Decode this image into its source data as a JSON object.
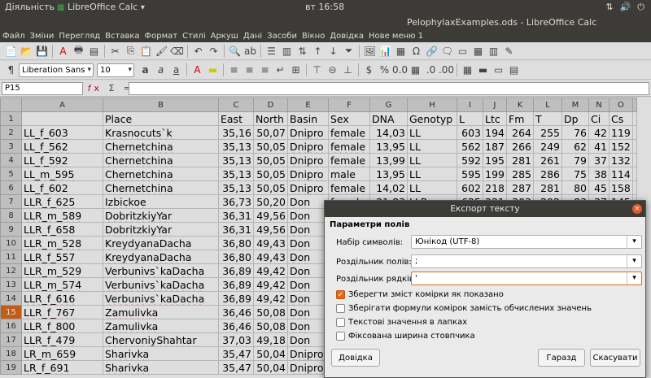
{
  "top_panel": {
    "activities": "Діяльність",
    "app": "LibreOffice Calc",
    "clock": "вт 16:58"
  },
  "window": {
    "title": "PelophylaxExamples.ods - LibreOffice Calc"
  },
  "menu": [
    "Файл",
    "Зміни",
    "Перегляд",
    "Вставка",
    "Формат",
    "Стилі",
    "Аркуш",
    "Дані",
    "Засоби",
    "Вікно",
    "Довідка",
    "Нове меню 1"
  ],
  "toolbar": {
    "font_name": "Liberation Sans",
    "font_size": "10"
  },
  "formula_bar": {
    "cell_ref": "P15",
    "fx": "Σ ="
  },
  "columns": [
    "A",
    "B",
    "C",
    "D",
    "E",
    "F",
    "G",
    "H",
    "I",
    "J",
    "K",
    "L",
    "M",
    "N",
    "O"
  ],
  "rows": [
    {
      "n": "1",
      "A": "",
      "B": "Place",
      "C": "East",
      "D": "North",
      "E": "Basin",
      "F": "Sex",
      "G": "DNA",
      "H": "Genotyp",
      "I": "L",
      "J": "Ltc",
      "K": "Fm",
      "L": "T",
      "M": "Dp",
      "N": "Ci",
      "O": "Cs"
    },
    {
      "n": "2",
      "A": "LL_f_603",
      "B": "Krasnocuts`k",
      "C": "35,16",
      "D": "50,07",
      "E": "Dnipro",
      "F": "female",
      "G": "14,03",
      "H": "LL",
      "I": "603",
      "J": "194",
      "K": "264",
      "L": "255",
      "M": "76",
      "N": "42",
      "O": "119"
    },
    {
      "n": "3",
      "A": "LL_f_562",
      "B": "Chernetchina",
      "C": "35,13",
      "D": "50,05",
      "E": "Dnipro",
      "F": "female",
      "G": "13,95",
      "H": "LL",
      "I": "562",
      "J": "187",
      "K": "266",
      "L": "249",
      "M": "62",
      "N": "41",
      "O": "152"
    },
    {
      "n": "4",
      "A": "LL_f_592",
      "B": "Chernetchina",
      "C": "35,13",
      "D": "50,05",
      "E": "Dnipro",
      "F": "female",
      "G": "13,99",
      "H": "LL",
      "I": "592",
      "J": "195",
      "K": "281",
      "L": "261",
      "M": "79",
      "N": "37",
      "O": "132"
    },
    {
      "n": "5",
      "A": "LL_m_595",
      "B": "Chernetchina",
      "C": "35,13",
      "D": "50,05",
      "E": "Dnipro",
      "F": "male",
      "G": "13,95",
      "H": "LL",
      "I": "595",
      "J": "199",
      "K": "285",
      "L": "286",
      "M": "75",
      "N": "38",
      "O": "114"
    },
    {
      "n": "6",
      "A": "LL_f_602",
      "B": "Chernetchina",
      "C": "35,13",
      "D": "50,05",
      "E": "Dnipro",
      "F": "female",
      "G": "14,02",
      "H": "LL",
      "I": "602",
      "J": "218",
      "K": "287",
      "L": "281",
      "M": "80",
      "N": "45",
      "O": "158"
    },
    {
      "n": "7",
      "A": "LLR_f_625",
      "B": "Izbickoe",
      "C": "36,73",
      "D": "50,20",
      "E": "Don",
      "F": "female",
      "G": "21,83",
      "H": "LLR",
      "I": "625",
      "J": "221",
      "K": "303",
      "L": "292",
      "M": "83",
      "N": "37",
      "O": "145"
    },
    {
      "n": "8",
      "A": "LLR_m_589",
      "B": "DobritzkiyYar",
      "C": "36,31",
      "D": "49,56",
      "E": "Don",
      "F": "",
      "G": "",
      "H": "",
      "I": "",
      "J": "",
      "K": "",
      "L": "",
      "M": "",
      "N": "",
      "O": ""
    },
    {
      "n": "9",
      "A": "LLR_f_658",
      "B": "DobritzkiyYar",
      "C": "36,31",
      "D": "49,56",
      "E": "Don",
      "F": "",
      "G": "",
      "H": "",
      "I": "",
      "J": "",
      "K": "",
      "L": "",
      "M": "",
      "N": "",
      "O": ""
    },
    {
      "n": "10",
      "A": "LLR_m_528",
      "B": "KreydyanaDacha",
      "C": "36,80",
      "D": "49,43",
      "E": "Don",
      "F": "",
      "G": "",
      "H": "",
      "I": "",
      "J": "",
      "K": "",
      "L": "",
      "M": "",
      "N": "",
      "O": ""
    },
    {
      "n": "11",
      "A": "LLR_f_557",
      "B": "KreydyanaDacha",
      "C": "36,80",
      "D": "49,43",
      "E": "Don",
      "F": "",
      "G": "",
      "H": "",
      "I": "",
      "J": "",
      "K": "",
      "L": "",
      "M": "",
      "N": "",
      "O": ""
    },
    {
      "n": "12",
      "A": "LLR_m_529",
      "B": "Verbunivs`kaDacha",
      "C": "36,89",
      "D": "49,42",
      "E": "Don",
      "F": "",
      "G": "",
      "H": "",
      "I": "",
      "J": "",
      "K": "",
      "L": "",
      "M": "",
      "N": "",
      "O": ""
    },
    {
      "n": "13",
      "A": "LLR_m_574",
      "B": "Verbunivs`kaDacha",
      "C": "36,89",
      "D": "49,42",
      "E": "Don",
      "F": "",
      "G": "",
      "H": "",
      "I": "",
      "J": "",
      "K": "",
      "L": "",
      "M": "",
      "N": "",
      "O": ""
    },
    {
      "n": "14",
      "A": "LLR_f_616",
      "B": "Verbunivs`kaDacha",
      "C": "36,89",
      "D": "49,42",
      "E": "Don",
      "F": "",
      "G": "",
      "H": "",
      "I": "",
      "J": "",
      "K": "",
      "L": "",
      "M": "",
      "N": "",
      "O": ""
    },
    {
      "n": "15",
      "A": "LLR_f_767",
      "B": "Zamulivka",
      "C": "36,46",
      "D": "50,08",
      "E": "Don",
      "F": "",
      "G": "",
      "H": "",
      "I": "",
      "J": "",
      "K": "",
      "L": "",
      "M": "",
      "N": "",
      "O": ""
    },
    {
      "n": "16",
      "A": "LLR_f_800",
      "B": "Zamulivka",
      "C": "36,46",
      "D": "50,08",
      "E": "Don",
      "F": "",
      "G": "",
      "H": "",
      "I": "",
      "J": "",
      "K": "",
      "L": "",
      "M": "",
      "N": "",
      "O": ""
    },
    {
      "n": "17",
      "A": "LLR_f_479",
      "B": "ChervoniyShahtar",
      "C": "37,03",
      "D": "49,18",
      "E": "Don",
      "F": "",
      "G": "",
      "H": "",
      "I": "",
      "J": "",
      "K": "",
      "L": "",
      "M": "",
      "N": "",
      "O": ""
    },
    {
      "n": "18",
      "A": "LR_m_659",
      "B": "Sharivka",
      "C": "35,47",
      "D": "50,04",
      "E": "Dnipro",
      "F": "",
      "G": "",
      "H": "",
      "I": "",
      "J": "",
      "K": "",
      "L": "",
      "M": "",
      "N": "",
      "O": ""
    },
    {
      "n": "19",
      "A": "LR_f_691",
      "B": "Sharivka",
      "C": "35,47",
      "D": "50,04",
      "E": "Dnipro",
      "F": "",
      "G": "",
      "H": "",
      "I": "",
      "J": "",
      "K": "",
      "L": "",
      "M": "",
      "N": "",
      "O": ""
    }
  ],
  "selected_row": "15",
  "dialog": {
    "title": "Експорт тексту",
    "section": "Параметри полів",
    "charset_label": "Набір символів:",
    "charset_value": "Юнікод (UTF-8)",
    "field_delim_label": "Роздільник полів:",
    "field_delim_value": ";",
    "string_delim_label": "Роздільник рядків:",
    "string_delim_value": "'",
    "checkboxes": [
      {
        "label": "Зберегти зміст комірки як показано",
        "checked": true
      },
      {
        "label": "Зберігати формули комірок замість обчислених значень",
        "checked": false
      },
      {
        "label": "Текстові значення в лапках",
        "checked": false
      },
      {
        "label": "Фіксована ширина стовпчика",
        "checked": false
      }
    ],
    "help": "Довідка",
    "ok": "Гаразд",
    "cancel": "Скасувати"
  }
}
